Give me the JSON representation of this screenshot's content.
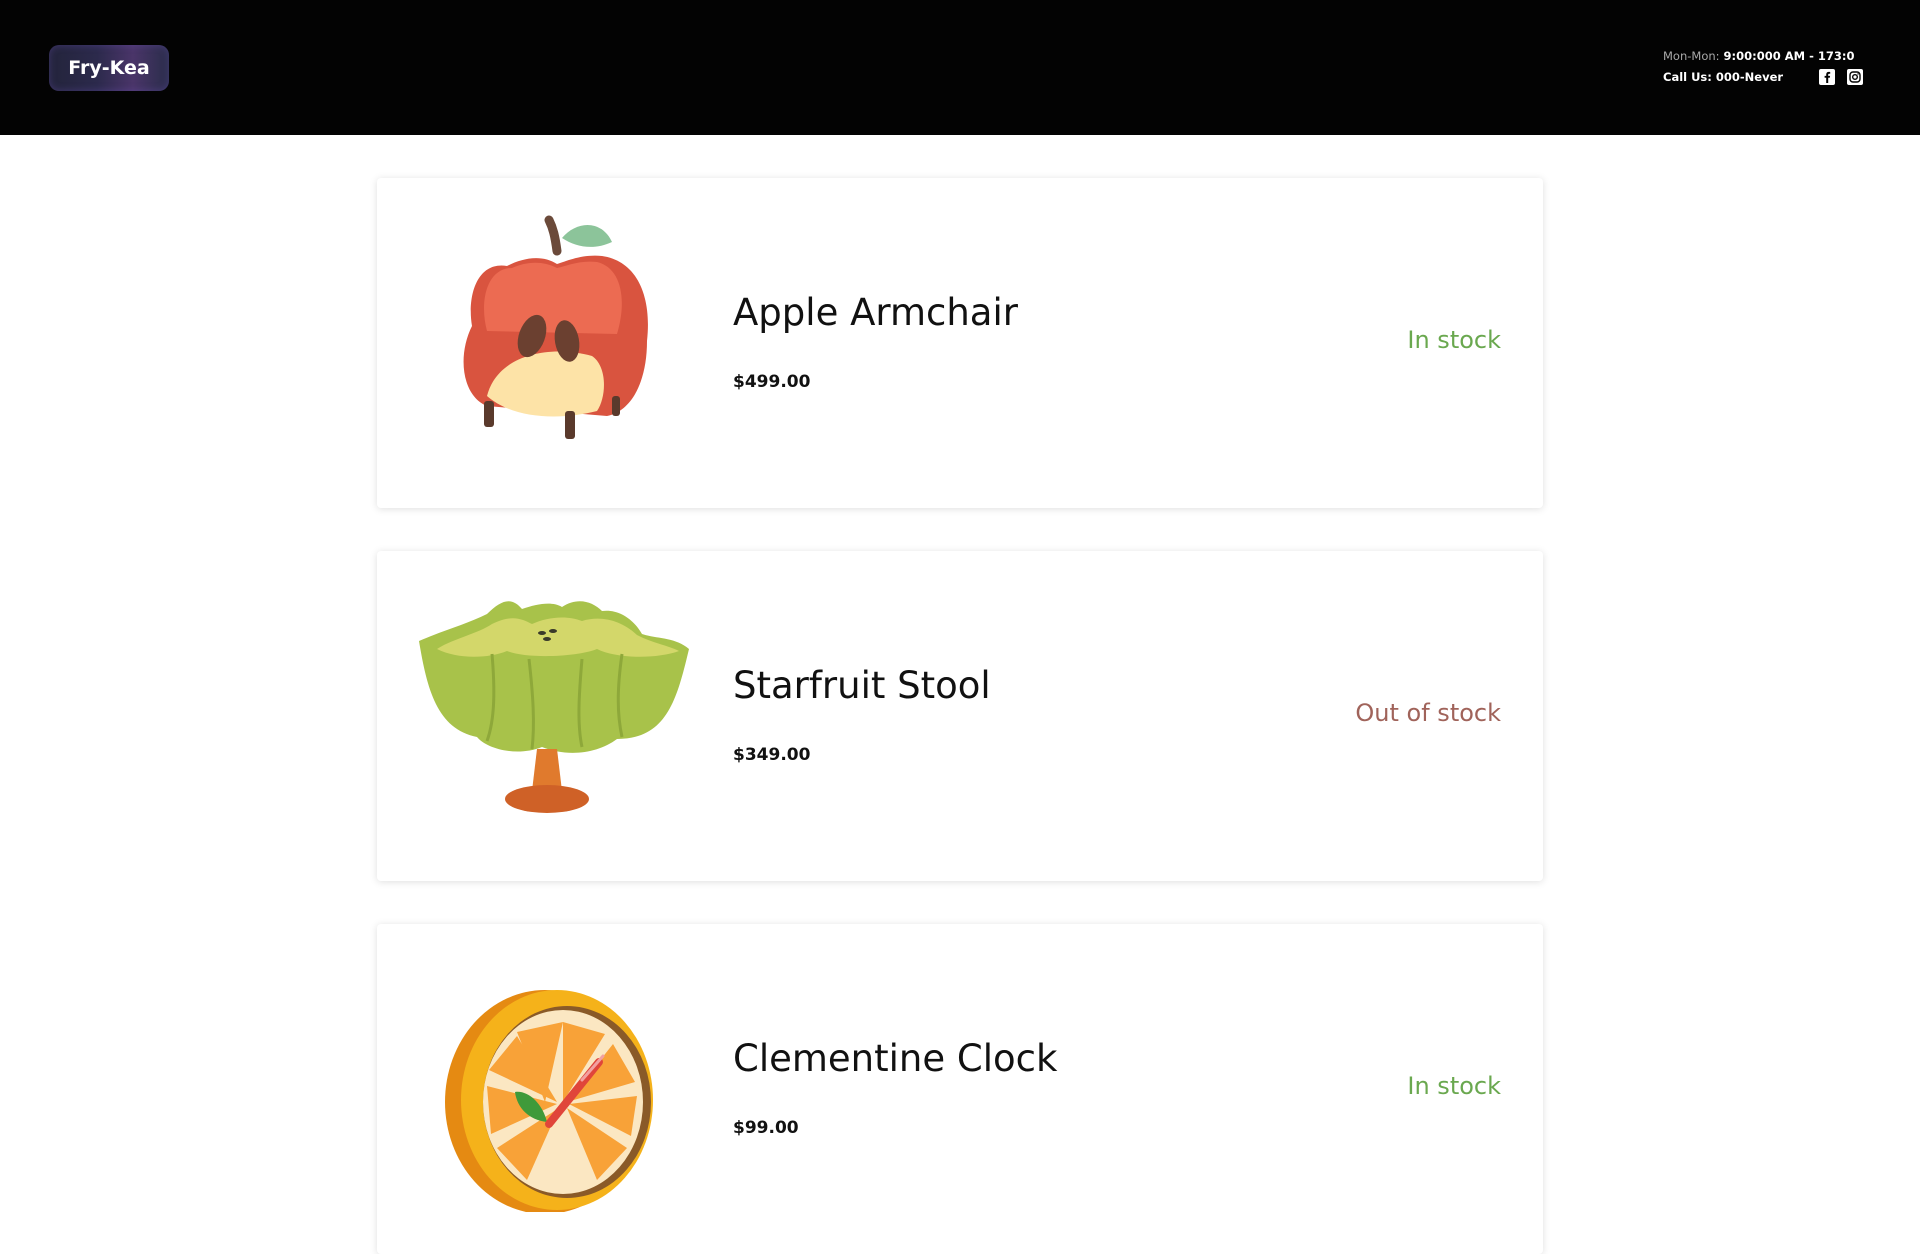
{
  "header": {
    "logo_text": "Fry-Kea",
    "hours_label": "Mon-Mon:",
    "hours_value": "9:00:000 AM - 173:0",
    "phone": "Call Us: 000-Never",
    "social_icons": [
      "facebook-icon",
      "instagram-icon"
    ]
  },
  "products": [
    {
      "name": "Apple Armchair",
      "price": "$499.00",
      "stock": "In stock",
      "stock_color": "#6aa84f",
      "icon": "apple-armchair-image"
    },
    {
      "name": "Starfruit Stool",
      "price": "$349.00",
      "stock": "Out of stock",
      "stock_color": "#a0635a",
      "icon": "starfruit-stool-image"
    },
    {
      "name": "Clementine Clock",
      "price": "$99.00",
      "stock": "In stock",
      "stock_color": "#6aa84f",
      "icon": "clementine-clock-image"
    }
  ],
  "colors": {
    "header_bg": "#030303",
    "in_stock": "#6aa84f",
    "out_of_stock": "#a0635a"
  }
}
